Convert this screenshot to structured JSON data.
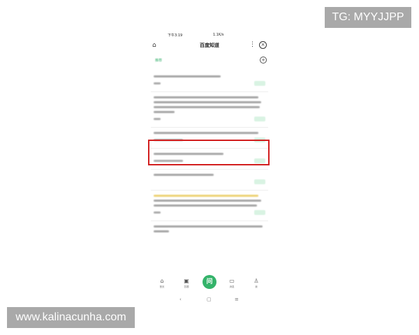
{
  "watermarks": {
    "top_right": "TG: MYYJJPP",
    "bottom_left": "www.kalinacunha.com"
  },
  "status_bar": {
    "time": "下午3:19",
    "system": "1.1K/s"
  },
  "header": {
    "title": "百度知道",
    "more_icon": "more-icon",
    "close_icon": "close-icon",
    "home_icon": "home-icon"
  },
  "tabs": {
    "active_tab": "推荐",
    "add_icon": "add-icon"
  },
  "bottom_nav": {
    "items": [
      {
        "label": "首页",
        "icon": "home-icon"
      },
      {
        "label": "答题",
        "icon": "answer-icon"
      },
      {
        "label": "问",
        "icon": "ask-icon"
      },
      {
        "label": "消息",
        "icon": "message-icon"
      },
      {
        "label": "我",
        "icon": "profile-icon"
      }
    ]
  },
  "system_nav": {
    "back": "‹",
    "home": "▢",
    "menu": "≡"
  },
  "colors": {
    "accent": "#34b36a",
    "highlight_border": "#d21e1e",
    "watermark_bg": "#a9a9a9"
  }
}
